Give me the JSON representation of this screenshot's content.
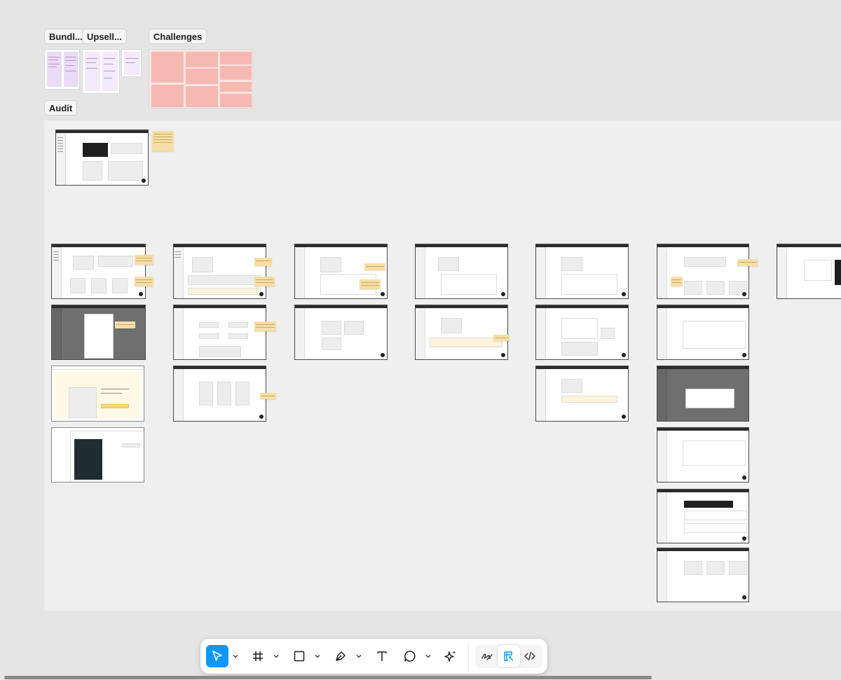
{
  "canvas": {
    "section_labels": {
      "bundles": "Bundl...",
      "upsell": "Upsell...",
      "challenges": "Challenges",
      "audit": "Audit"
    }
  },
  "toolbar": {
    "tools": [
      {
        "name": "move",
        "icon": "cursor-arrow-icon",
        "active": true
      },
      {
        "name": "frame",
        "icon": "hash-frame-icon"
      },
      {
        "name": "rectangle",
        "icon": "square-icon"
      },
      {
        "name": "pen",
        "icon": "pen-nib-icon"
      },
      {
        "name": "text",
        "icon": "text-t-icon"
      },
      {
        "name": "comment",
        "icon": "speech-bubble-icon"
      },
      {
        "name": "actions",
        "icon": "sparkles-icon"
      },
      {
        "name": "draw",
        "icon": "scribble-icon"
      },
      {
        "name": "design-mode",
        "icon": "design-palette-icon",
        "active": true
      },
      {
        "name": "dev-mode",
        "icon": "code-brackets-icon"
      }
    ]
  },
  "colors": {
    "accent": "#0d99ff",
    "canvas_bg": "#e5e5e5",
    "section_bg": "#efefef",
    "sticky": "#f6dfa6",
    "challenge_box": "#f6b9b2",
    "bundle_column": "#eadcf6"
  }
}
